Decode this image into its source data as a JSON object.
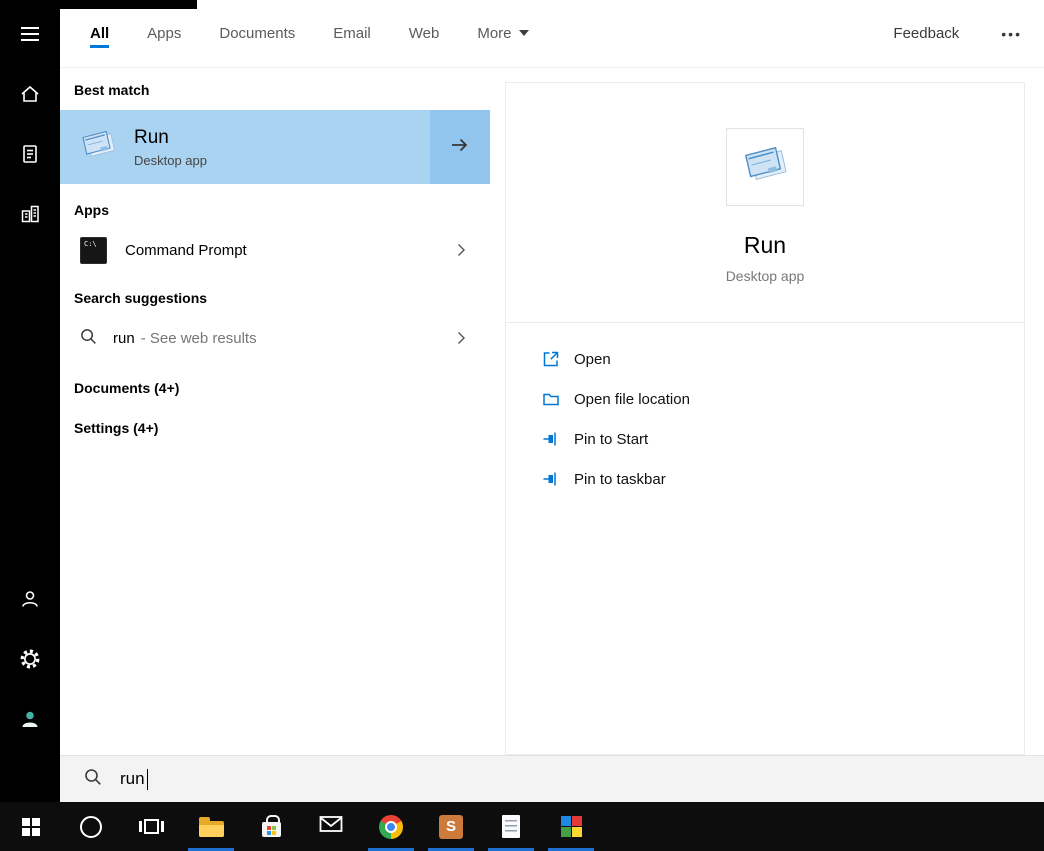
{
  "colors": {
    "accent": "#0078d7",
    "best_match_bg": "#aad3f2",
    "best_match_arrow_bg": "#92c5ed",
    "sidebar_bg": "#000000",
    "taskbar_bg": "#0d0d0d",
    "running_indicator": "#1f6fd0"
  },
  "sidebar": {
    "icons": [
      "menu",
      "home",
      "notebook",
      "organization",
      "user",
      "settings",
      "account"
    ]
  },
  "header": {
    "tabs": [
      {
        "label": "All",
        "active": true
      },
      {
        "label": "Apps",
        "active": false
      },
      {
        "label": "Documents",
        "active": false
      },
      {
        "label": "Email",
        "active": false
      },
      {
        "label": "Web",
        "active": false
      },
      {
        "label": "More",
        "active": false,
        "has_dropdown": true
      }
    ],
    "feedback": "Feedback",
    "overflow": "•••"
  },
  "results": {
    "best_match_label": "Best match",
    "best_match": {
      "title": "Run",
      "subtitle": "Desktop app"
    },
    "apps_label": "Apps",
    "apps": [
      {
        "label": "Command Prompt",
        "icon_glyph": "C:\\"
      }
    ],
    "suggestions_label": "Search suggestions",
    "suggestions": [
      {
        "query": "run",
        "hint": "- See web results"
      }
    ],
    "groups": [
      {
        "label": "Documents (4+)"
      },
      {
        "label": "Settings (4+)"
      }
    ]
  },
  "preview": {
    "title": "Run",
    "subtitle": "Desktop app",
    "actions": [
      {
        "label": "Open",
        "icon": "open-icon"
      },
      {
        "label": "Open file location",
        "icon": "folder-icon"
      },
      {
        "label": "Pin to Start",
        "icon": "pin-icon"
      },
      {
        "label": "Pin to taskbar",
        "icon": "pin-icon"
      }
    ]
  },
  "search": {
    "value": "run"
  },
  "taskbar": {
    "icons": [
      {
        "name": "start",
        "running": false
      },
      {
        "name": "cortana",
        "running": false
      },
      {
        "name": "task-view",
        "running": false
      },
      {
        "name": "file-explorer",
        "running": true
      },
      {
        "name": "store",
        "running": false
      },
      {
        "name": "mail",
        "running": false
      },
      {
        "name": "chrome",
        "running": true
      },
      {
        "name": "sublime-text",
        "running": true,
        "glyph": "S"
      },
      {
        "name": "notepad",
        "running": true
      },
      {
        "name": "colorful-app",
        "running": true
      }
    ]
  }
}
